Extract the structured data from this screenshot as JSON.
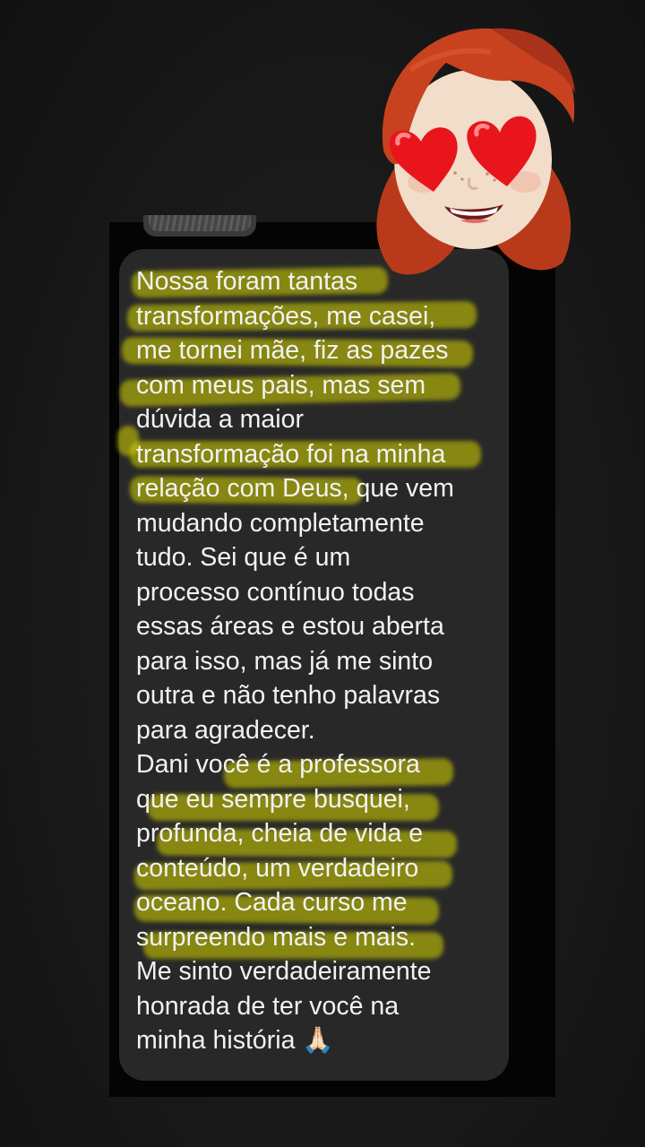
{
  "story": {
    "background_color": "#111111",
    "highlighter_color": "#d6d600"
  },
  "message": {
    "bubble_color": "#282828",
    "text_color": "#f2f2f2",
    "text": "Nossa foram tantas\ntransformações, me casei,\nme tornei mãe, fiz as pazes\ncom meus pais, mas sem\ndúvida a maior\ntransformação foi na minha\nrelação com Deus, que vem\nmudando completamente\ntudo. Sei que é um\nprocesso contínuo todas\nessas áreas e estou aberta\npara isso, mas já me sinto\noutra e não tenho palavras\npara agradecer.\nDani você é a professora\nque eu sempre busquei,\nprofunda, cheia de vida e\nconteúdo, um verdadeiro\noceano. Cada curso me\nsurpreendo mais e mais.\nMe sinto verdadeiramente\nhonrada de ter você na\nminha história 🙏🏻"
  },
  "sticker": {
    "icon": "memoji-heart-eyes-icon",
    "hair_color": "#c8421f",
    "heart_color": "#e8151c"
  }
}
